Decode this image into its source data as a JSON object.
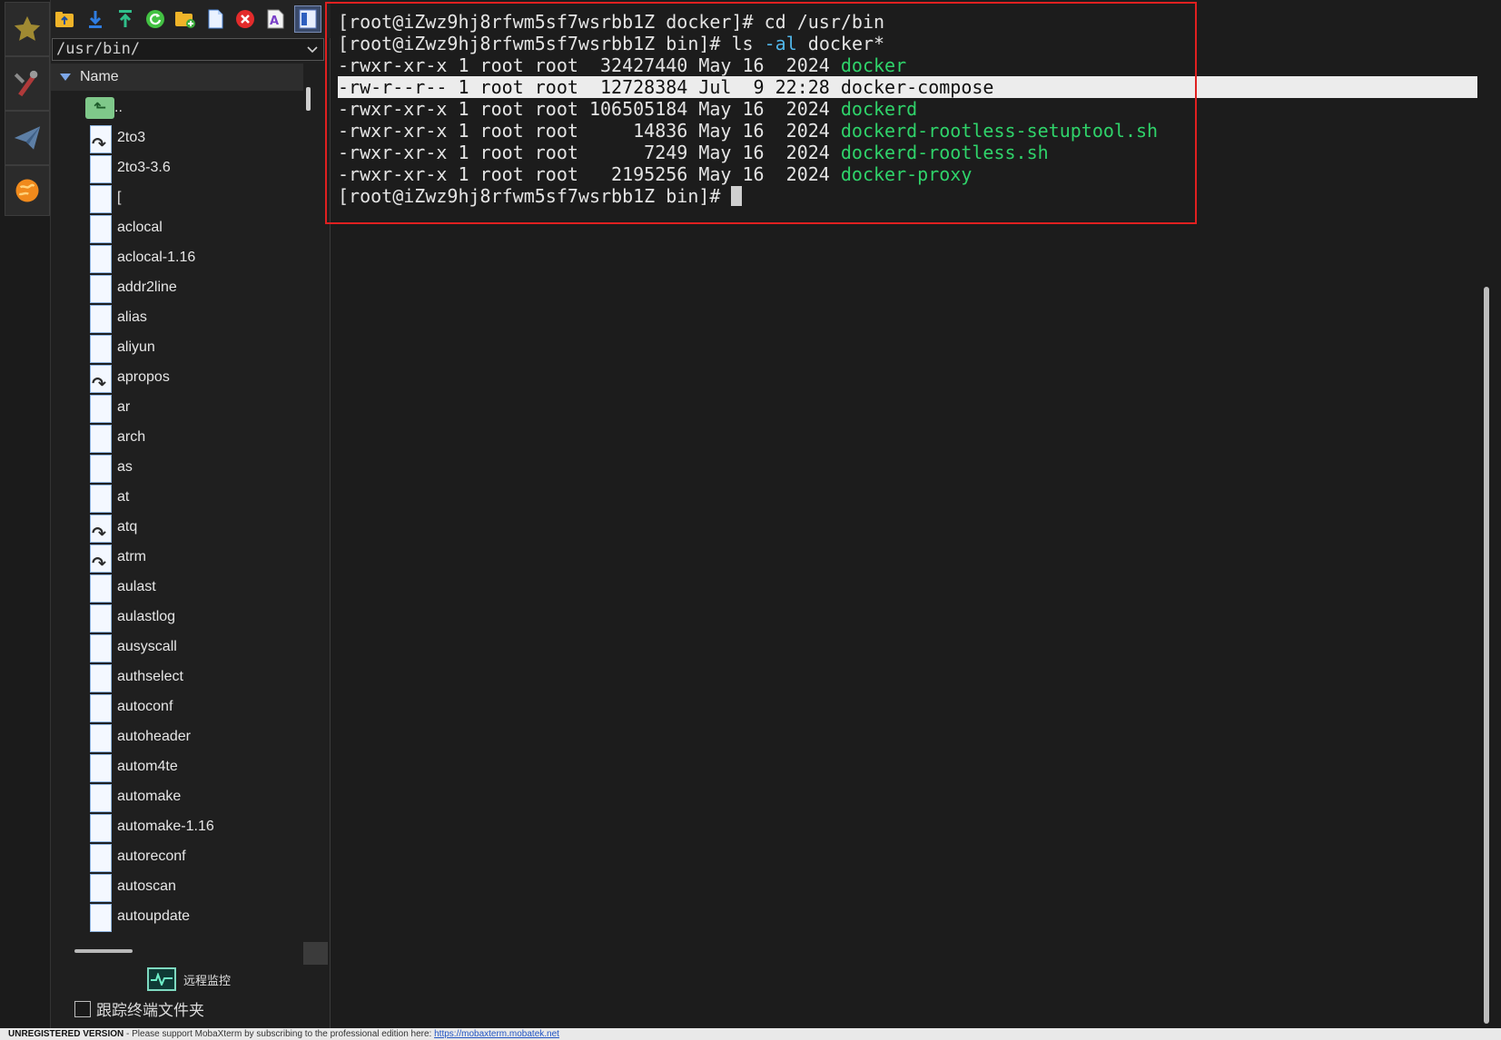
{
  "sidebar": {
    "tabs": [
      {
        "icon": "star-icon"
      },
      {
        "icon": "tools-icon"
      },
      {
        "icon": "paper-plane-icon"
      },
      {
        "icon": "globe-icon"
      }
    ]
  },
  "browser": {
    "toolbar": [
      {
        "icon": "folder-up-icon"
      },
      {
        "icon": "download-icon"
      },
      {
        "icon": "upload-icon"
      },
      {
        "icon": "refresh-icon"
      },
      {
        "icon": "new-folder-icon"
      },
      {
        "icon": "new-file-icon"
      },
      {
        "icon": "delete-icon"
      },
      {
        "icon": "text-editor-icon"
      },
      {
        "icon": "toggle-view-icon"
      }
    ],
    "path": "/usr/bin/",
    "column_header": "Name",
    "parent_entry": "..",
    "files": [
      {
        "name": "2to3",
        "link": true
      },
      {
        "name": "2to3-3.6",
        "link": false
      },
      {
        "name": "[",
        "link": false
      },
      {
        "name": "aclocal",
        "link": false
      },
      {
        "name": "aclocal-1.16",
        "link": false
      },
      {
        "name": "addr2line",
        "link": false
      },
      {
        "name": "alias",
        "link": false
      },
      {
        "name": "aliyun",
        "link": false
      },
      {
        "name": "apropos",
        "link": true
      },
      {
        "name": "ar",
        "link": false
      },
      {
        "name": "arch",
        "link": false
      },
      {
        "name": "as",
        "link": false
      },
      {
        "name": "at",
        "link": false
      },
      {
        "name": "atq",
        "link": true
      },
      {
        "name": "atrm",
        "link": true
      },
      {
        "name": "aulast",
        "link": false
      },
      {
        "name": "aulastlog",
        "link": false
      },
      {
        "name": "ausyscall",
        "link": false
      },
      {
        "name": "authselect",
        "link": false
      },
      {
        "name": "autoconf",
        "link": false
      },
      {
        "name": "autoheader",
        "link": false
      },
      {
        "name": "autom4te",
        "link": false
      },
      {
        "name": "automake",
        "link": false
      },
      {
        "name": "automake-1.16",
        "link": false
      },
      {
        "name": "autoreconf",
        "link": false
      },
      {
        "name": "autoscan",
        "link": false
      },
      {
        "name": "autoupdate",
        "link": false
      }
    ],
    "remote_monitor_label": "远程监控",
    "follow_folder_label": "跟踪终端文件夹"
  },
  "terminal": {
    "lines": [
      {
        "segments": [
          {
            "text": "[root@iZwz9hj8rfwm5sf7wsrbb1Z docker]# cd /usr/bin",
            "color": "default"
          }
        ],
        "highlight": false
      },
      {
        "segments": [
          {
            "text": "[root@iZwz9hj8rfwm5sf7wsrbb1Z bin]# ls ",
            "color": "default"
          },
          {
            "text": "-al",
            "color": "cyan"
          },
          {
            "text": " docker*",
            "color": "default"
          }
        ],
        "highlight": false
      },
      {
        "segments": [
          {
            "text": "-rwxr-xr-x 1 root root  32427440 May 16  2024 ",
            "color": "default"
          },
          {
            "text": "docker",
            "color": "green"
          }
        ],
        "highlight": false
      },
      {
        "segments": [
          {
            "text": "-rw-r--r-- 1 root root  12728384 Jul  9 22:28 docker-compose",
            "color": "default"
          }
        ],
        "highlight": true
      },
      {
        "segments": [
          {
            "text": "-rwxr-xr-x 1 root root 106505184 May 16  2024 ",
            "color": "default"
          },
          {
            "text": "dockerd",
            "color": "green"
          }
        ],
        "highlight": false
      },
      {
        "segments": [
          {
            "text": "-rwxr-xr-x 1 root root     14836 May 16  2024 ",
            "color": "default"
          },
          {
            "text": "dockerd-rootless-setuptool.sh",
            "color": "green"
          }
        ],
        "highlight": false
      },
      {
        "segments": [
          {
            "text": "-rwxr-xr-x 1 root root      7249 May 16  2024 ",
            "color": "default"
          },
          {
            "text": "dockerd-rootless.sh",
            "color": "green"
          }
        ],
        "highlight": false
      },
      {
        "segments": [
          {
            "text": "-rwxr-xr-x 1 root root   2195256 May 16  2024 ",
            "color": "default"
          },
          {
            "text": "docker-proxy",
            "color": "green"
          }
        ],
        "highlight": false
      },
      {
        "segments": [
          {
            "text": "[root@iZwz9hj8rfwm5sf7wsrbb1Z bin]# ",
            "color": "default"
          }
        ],
        "highlight": false,
        "cursor": true
      }
    ],
    "colors": {
      "green": "#2fd36a",
      "cyan": "#51b5e8",
      "highlight_bg": "#ececec",
      "box": "#e02020"
    }
  },
  "statusbar": {
    "unregistered": "UNREGISTERED VERSION",
    "message": " -  Please support MobaXterm by subscribing to the professional edition here: ",
    "link": "https://mobaxterm.mobatek.net"
  }
}
